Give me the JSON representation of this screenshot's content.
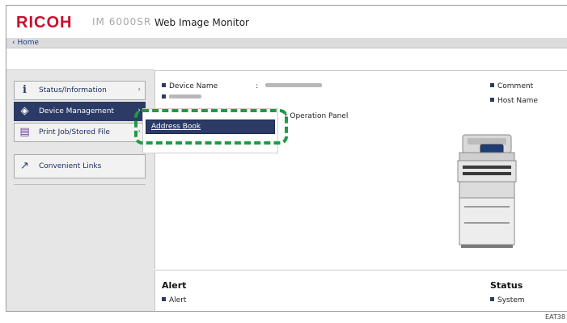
{
  "header": {
    "logo": "RICOH",
    "model": "IM 6000SR",
    "title": "Web Image Monitor",
    "home_link": "‹ Home"
  },
  "sidebar": {
    "items": [
      {
        "label": "Status/Information",
        "icon": "info-icon",
        "arrow": "›"
      },
      {
        "label": "Device Management",
        "icon": "settings-diamond-icon",
        "arrow": "›"
      },
      {
        "label": "Print Job/Stored File",
        "icon": "document-icon",
        "arrow": "›"
      },
      {
        "label": "Convenient Links",
        "icon": "link-arrow-icon",
        "arrow": ""
      }
    ]
  },
  "dropdown": {
    "selected_label": "Address Book"
  },
  "main": {
    "device_name_label": "Device Name",
    "device_name_sep": ":",
    "comment_label": "Comment",
    "host_name_label": "Host Name",
    "operation_panel_text": "t Operation Panel"
  },
  "bottom": {
    "alert_heading": "Alert",
    "alert_item": "Alert",
    "status_heading": "Status",
    "status_item": "System"
  },
  "footer": {
    "code": "EAT38"
  },
  "colors": {
    "brand_red": "#c8102e",
    "nav_active": "#2b3b66",
    "highlight_green": "#1f9a45"
  }
}
